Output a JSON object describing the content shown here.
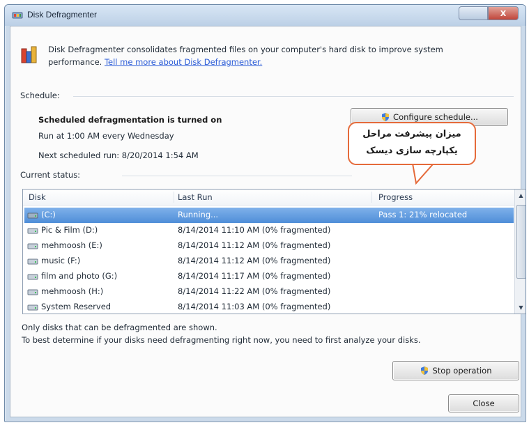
{
  "window": {
    "title": "Disk Defragmenter",
    "help_label": "",
    "close_label": "X"
  },
  "header": {
    "description": "Disk Defragmenter consolidates fragmented files on your computer's hard disk to improve system performance.",
    "link": "Tell me more about Disk Defragmenter."
  },
  "schedule": {
    "section_label": "Schedule:",
    "status": "Scheduled defragmentation is turned on",
    "run_at": "Run at 1:00 AM every Wednesday",
    "next_run": "Next scheduled run: 8/20/2014 1:54 AM",
    "configure_button": "Configure schedule..."
  },
  "callout": {
    "line1": "میزان پیشرفت مراحل",
    "line2": "یکپارچه سازی دیسک"
  },
  "current_status": {
    "section_label": "Current status:",
    "columns": [
      "Disk",
      "Last Run",
      "Progress"
    ],
    "rows": [
      {
        "disk": "(C:)",
        "last_run": "Running...",
        "progress": "Pass 1: 21% relocated",
        "selected": true
      },
      {
        "disk": "Pic & Film (D:)",
        "last_run": "8/14/2014 11:10 AM (0% fragmented)",
        "progress": "",
        "selected": false
      },
      {
        "disk": "mehmoosh (E:)",
        "last_run": "8/14/2014 11:12 AM (0% fragmented)",
        "progress": "",
        "selected": false
      },
      {
        "disk": "music (F:)",
        "last_run": "8/14/2014 11:12 AM (0% fragmented)",
        "progress": "",
        "selected": false
      },
      {
        "disk": "film and photo (G:)",
        "last_run": "8/14/2014 11:17 AM (0% fragmented)",
        "progress": "",
        "selected": false
      },
      {
        "disk": "mehmoosh (H:)",
        "last_run": "8/14/2014 11:22 AM (0% fragmented)",
        "progress": "",
        "selected": false
      },
      {
        "disk": "System Reserved",
        "last_run": "8/14/2014 11:03 AM (0% fragmented)",
        "progress": "",
        "selected": false
      }
    ]
  },
  "notes": {
    "line1": "Only disks that can be defragmented are shown.",
    "line2": "To best determine if your disks need defragmenting right now, you need to first analyze your disks."
  },
  "buttons": {
    "stop": "Stop operation",
    "close": "Close"
  },
  "colors": {
    "selection": "#4f8ed8",
    "link": "#2a5bd7",
    "callout_border": "#e56a3a"
  }
}
